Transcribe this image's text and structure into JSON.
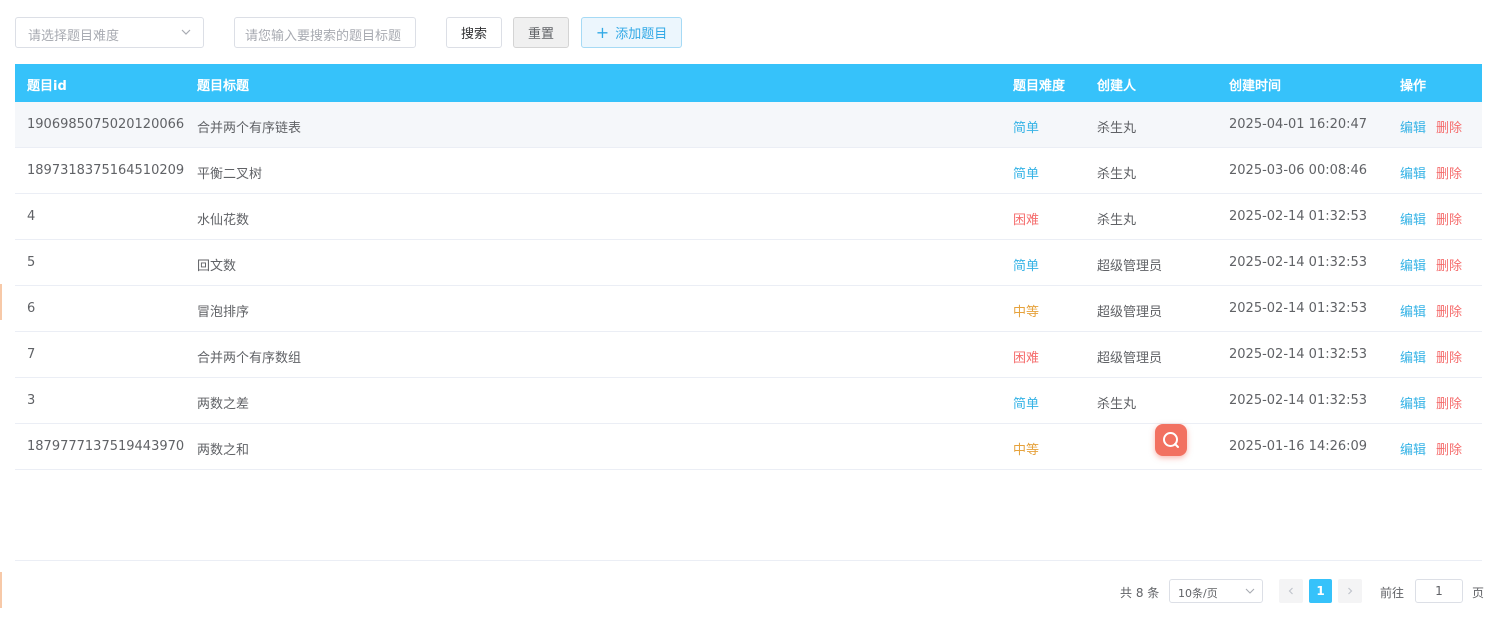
{
  "toolbar": {
    "difficulty_placeholder": "请选择题目难度",
    "search_placeholder": "请您输入要搜索的题目标题",
    "search_label": "搜索",
    "reset_label": "重置",
    "add_label": "添加题目"
  },
  "table": {
    "headers": {
      "id": "题目id",
      "title": "题目标题",
      "difficulty": "题目难度",
      "creator": "创建人",
      "created_at": "创建时间",
      "ops": "操作"
    },
    "rows": [
      {
        "id": "1906985075020120066",
        "title": "合并两个有序链表",
        "difficulty": "简单",
        "level": "easy",
        "creator": "杀生丸",
        "created_at": "2025-04-01 16:20:47",
        "edit": "编辑",
        "delete": "删除"
      },
      {
        "id": "1897318375164510209",
        "title": "平衡二叉树",
        "difficulty": "简单",
        "level": "easy",
        "creator": "杀生丸",
        "created_at": "2025-03-06 00:08:46",
        "edit": "编辑",
        "delete": "删除"
      },
      {
        "id": "4",
        "title": "水仙花数",
        "difficulty": "困难",
        "level": "hard",
        "creator": "杀生丸",
        "created_at": "2025-02-14 01:32:53",
        "edit": "编辑",
        "delete": "删除"
      },
      {
        "id": "5",
        "title": "回文数",
        "difficulty": "简单",
        "level": "easy",
        "creator": "超级管理员",
        "created_at": "2025-02-14 01:32:53",
        "edit": "编辑",
        "delete": "删除"
      },
      {
        "id": "6",
        "title": "冒泡排序",
        "difficulty": "中等",
        "level": "medium",
        "creator": "超级管理员",
        "created_at": "2025-02-14 01:32:53",
        "edit": "编辑",
        "delete": "删除"
      },
      {
        "id": "7",
        "title": "合并两个有序数组",
        "difficulty": "困难",
        "level": "hard",
        "creator": "超级管理员",
        "created_at": "2025-02-14 01:32:53",
        "edit": "编辑",
        "delete": "删除"
      },
      {
        "id": "3",
        "title": "两数之差",
        "difficulty": "简单",
        "level": "easy",
        "creator": "杀生丸",
        "created_at": "2025-02-14 01:32:53",
        "edit": "编辑",
        "delete": "删除"
      },
      {
        "id": "1879777137519443970",
        "title": "两数之和",
        "difficulty": "中等",
        "level": "medium",
        "creator": "",
        "created_at": "2025-01-16 14:26:09",
        "edit": "编辑",
        "delete": "删除"
      }
    ]
  },
  "pagination": {
    "total": "共 8 条",
    "page_size": "10条/页",
    "current_page": "1",
    "goto_label": "前往",
    "goto_value": "1",
    "page_suffix": "页"
  },
  "colors": {
    "header_bg": "#36c2fa",
    "easy": "#36b3e6",
    "medium": "#e6a23c",
    "hard": "#f56c6c",
    "float_button": "#f27161"
  }
}
